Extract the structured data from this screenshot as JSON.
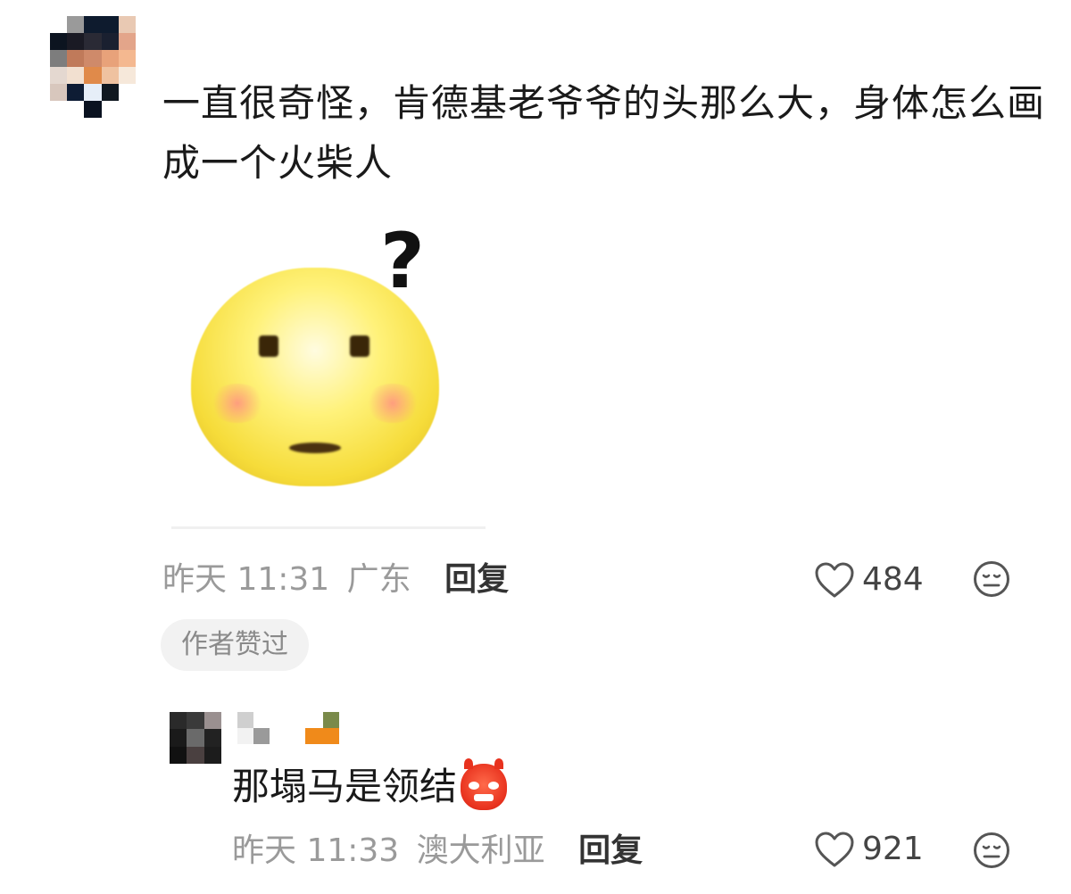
{
  "comment": {
    "text": "一直很奇怪，肯德基老爷爷的头那么大，身体怎么画成一个火柴人",
    "time": "昨天 11:31",
    "location": "广东",
    "reply_label": "回复",
    "likes": "484",
    "author_liked_badge": "作者赞过",
    "emoji_image": {
      "question_mark": "?"
    }
  },
  "reply": {
    "text": "那塌马是领结",
    "time": "昨天 11:33",
    "location": "澳大利亚",
    "reply_label": "回复",
    "likes": "921"
  },
  "icons": {
    "like": "heart-outline-icon",
    "dislike": "meh-face-icon",
    "reply_emoji": "angry-devil-emoji"
  },
  "colors": {
    "meta_text": "#9a9a9a",
    "badge_bg": "#f2f2f2"
  }
}
